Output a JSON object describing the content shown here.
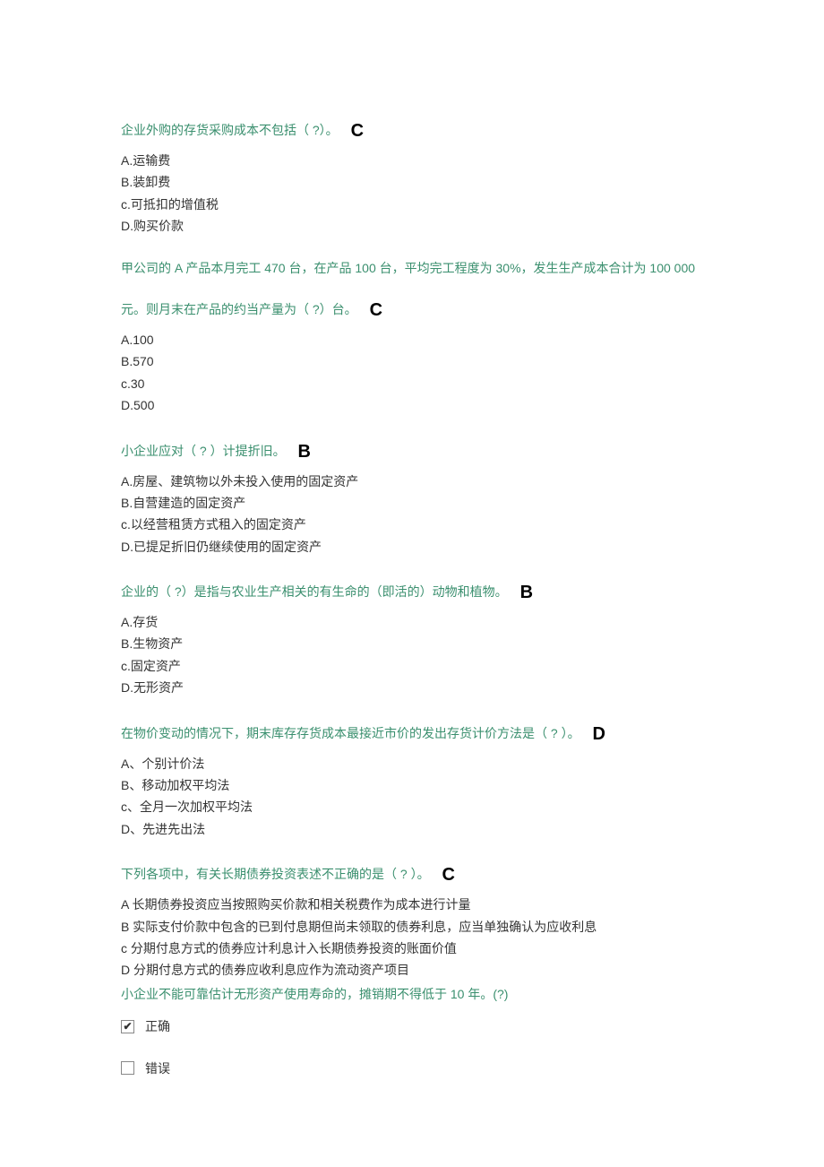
{
  "questions": [
    {
      "stem": "企业外购的存货采购成本不包括（ ?）。",
      "answer": "C",
      "options": [
        "A.运输费",
        "B.装卸费",
        "c.可抵扣的增值税",
        "D.购买价款"
      ]
    },
    {
      "stem_line1": "甲公司的 A 产品本月完工 470 台，在产品 100 台，平均完工程度为 30%，发生生产成本合计为 100 000",
      "stem_line2": "元。则月末在产品的约当产量为（ ?）台。",
      "answer": "C",
      "options": [
        "A.100",
        "B.570",
        "c.30",
        "D.500"
      ]
    },
    {
      "stem": "小企业应对（  ?   ）计提折旧。",
      "answer": "B",
      "options": [
        "A.房屋、建筑物以外未投入使用的固定资产",
        "B.自营建造的固定资产",
        "c.以经营租赁方式租入的固定资产",
        "D.已提足折旧仍继续使用的固定资产"
      ]
    },
    {
      "stem": "企业的（ ?）是指与农业生产相关的有生命的（即活的）动物和植物。",
      "answer": "B",
      "options": [
        "A.存货",
        "B.生物资产",
        "c.固定资产",
        "D.无形资产"
      ]
    },
    {
      "stem": "在物价变动的情况下，期末库存存货成本最接近市价的发出存货计价方法是（  ?  ）。",
      "answer": "D",
      "options": [
        "A、个别计价法",
        "B、移动加权平均法",
        "c、全月一次加权平均法",
        "D、先进先出法"
      ]
    },
    {
      "stem": "下列各项中，有关长期债券投资表述不正确的是（  ?  ）。",
      "answer": "C",
      "options": [
        "A  长期债券投资应当按照购买价款和相关税费作为成本进行计量",
        "B  实际支付价款中包含的已到付息期但尚未领取的债券利息，应当单独确认为应收利息",
        "c  分期付息方式的债券应计利息计入长期债券投资的账面价值",
        "D  分期付息方式的债券应收利息应作为流动资产项目"
      ]
    }
  ],
  "q7": {
    "stem": "小企业不能可靠估计无形资产使用寿命的，摊销期不得低于 10 年。(?)",
    "true_label": "正确",
    "false_label": "错误",
    "checked": "true_opt"
  }
}
